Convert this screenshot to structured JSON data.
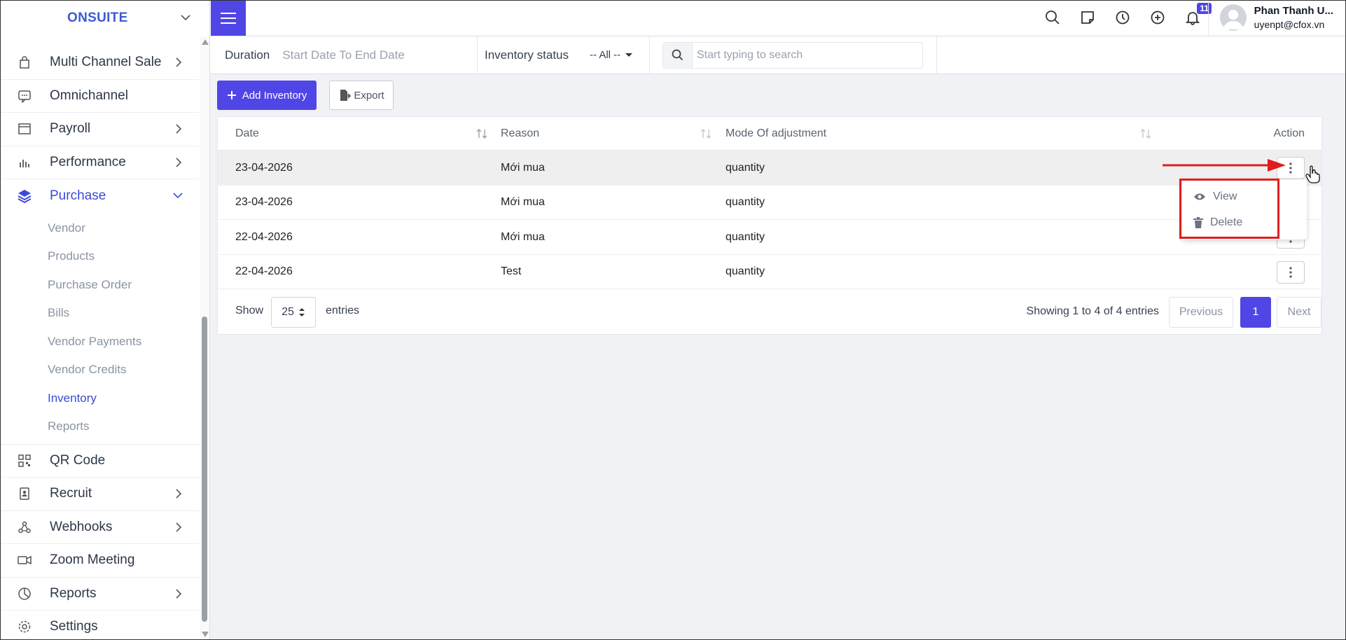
{
  "app": {
    "brand": "ONSUITE"
  },
  "sidebar": {
    "items": [
      {
        "label": "Multi Channel Sale",
        "icon": "shopping-bag-icon",
        "has_children": true
      },
      {
        "label": "Omnichannel",
        "icon": "chat-bubble-icon",
        "has_children": false
      },
      {
        "label": "Payroll",
        "icon": "browser-window-icon",
        "has_children": true
      },
      {
        "label": "Performance",
        "icon": "bar-chart-icon",
        "has_children": true
      },
      {
        "label": "Purchase",
        "icon": "layers-icon",
        "has_children": true,
        "expanded": true
      },
      {
        "label": "QR Code",
        "icon": "qr-code-icon",
        "has_children": false
      },
      {
        "label": "Recruit",
        "icon": "id-badge-icon",
        "has_children": true
      },
      {
        "label": "Webhooks",
        "icon": "webhook-icon",
        "has_children": true
      },
      {
        "label": "Zoom Meeting",
        "icon": "video-camera-icon",
        "has_children": false
      },
      {
        "label": "Reports",
        "icon": "pie-chart-icon",
        "has_children": true
      },
      {
        "label": "Settings",
        "icon": "gear-icon",
        "has_children": false
      }
    ],
    "purchase_sub": [
      {
        "label": "Vendor"
      },
      {
        "label": "Products"
      },
      {
        "label": "Purchase Order"
      },
      {
        "label": "Bills"
      },
      {
        "label": "Vendor Payments"
      },
      {
        "label": "Vendor Credits"
      },
      {
        "label": "Inventory",
        "active": true
      },
      {
        "label": "Reports"
      }
    ]
  },
  "topbar": {
    "notifications_count": "11",
    "user": {
      "name": "Phan Thanh U...",
      "email": "uyenpt@cfox.vn"
    }
  },
  "filters": {
    "duration_label": "Duration",
    "duration_placeholder": "Start Date To End Date",
    "status_label": "Inventory status",
    "status_value": "-- All --",
    "search_placeholder": "Start typing to search"
  },
  "actions": {
    "add_label": "Add Inventory",
    "export_label": "Export"
  },
  "table": {
    "columns": [
      "Date",
      "Reason",
      "Mode Of adjustment",
      "Action"
    ],
    "rows": [
      {
        "date": "23-04-2026",
        "reason": "Mới mua",
        "mode": "quantity"
      },
      {
        "date": "23-04-2026",
        "reason": "Mới mua",
        "mode": "quantity"
      },
      {
        "date": "22-04-2026",
        "reason": "Mới mua",
        "mode": "quantity"
      },
      {
        "date": "22-04-2026",
        "reason": "Test",
        "mode": "quantity"
      }
    ]
  },
  "footer": {
    "show_label": "Show",
    "page_size": "25",
    "entries_label": "entries",
    "showing": "Showing 1 to 4 of 4 entries",
    "prev": "Previous",
    "page": "1",
    "next": "Next"
  },
  "row_menu": {
    "view": "View",
    "delete": "Delete"
  },
  "colors": {
    "accent": "#4f46e5",
    "annotation": "#e11d1d"
  }
}
